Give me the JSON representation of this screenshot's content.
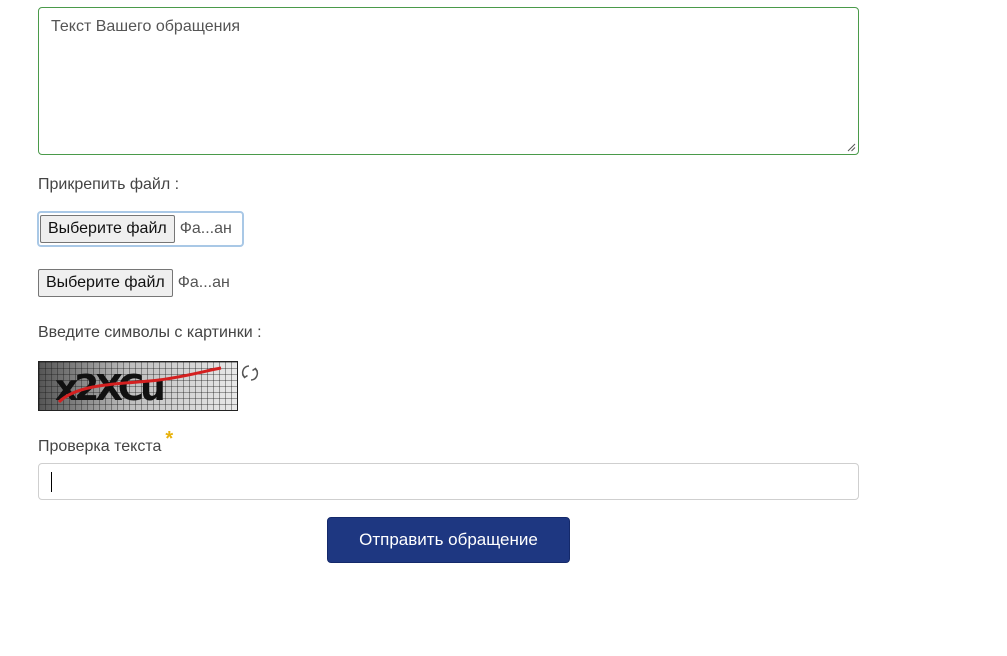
{
  "message": {
    "placeholder": "Текст Вашего обращения"
  },
  "attachments": {
    "label": "Прикрепить файл :",
    "inputs": [
      {
        "button_label": "Выберите файл",
        "status": "Фа...ан"
      },
      {
        "button_label": "Выберите файл",
        "status": "Фа...ан"
      }
    ]
  },
  "captcha": {
    "label": "Введите символы с картинки :",
    "image_text": "x2XCu",
    "refresh_icon": "refresh-icon"
  },
  "verification": {
    "label": "Проверка текста",
    "required_mark": "*",
    "value": ""
  },
  "submit": {
    "label": "Отправить обращение"
  },
  "colors": {
    "textarea_border": "#4a9a4a",
    "submit_bg": "#1e3781",
    "required_star": "#e8b20c",
    "focus_ring": "#a9c8e6"
  }
}
